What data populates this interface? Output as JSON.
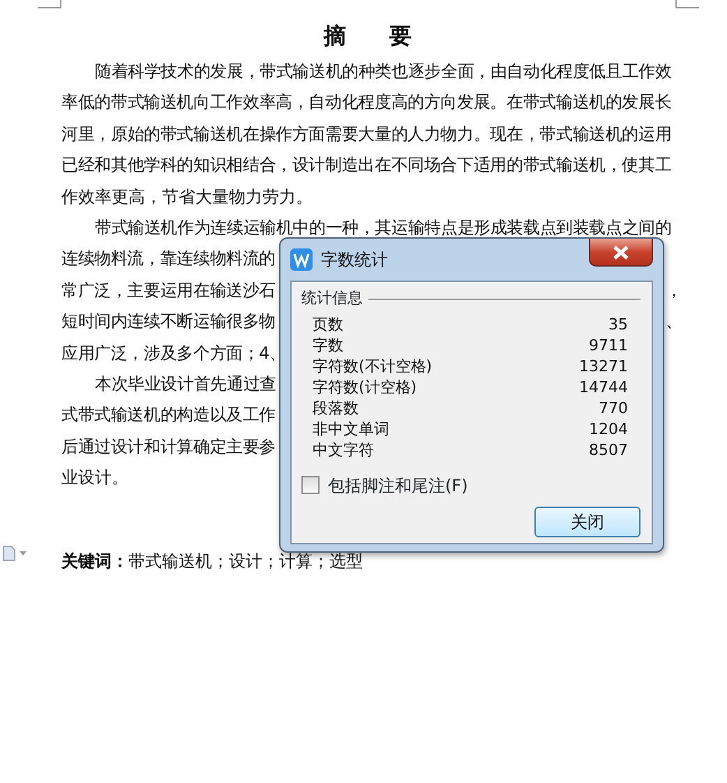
{
  "document": {
    "title": "摘 要",
    "lines": [
      {
        "text": "随着科学技术的发展，带式输送机的种类也逐步全面，由自动化程度低且工作效",
        "indent": true
      },
      {
        "text": "率低的带式输送机向工作效率高，自动化程度高的方向发展。在带式输送机的发展长",
        "indent": false
      },
      {
        "text": "河里，原始的带式输送机在操作方面需要大量的人力物力。现在，带式输送机的运用",
        "indent": false
      },
      {
        "text": "已经和其他学科的知识相结合，设计制造出在不同场合下适用的带式输送机，使其工",
        "indent": false
      },
      {
        "text": "作效率更高，节省大量物力劳力。",
        "indent": false,
        "last": true
      },
      {
        "text": "带式输送机作为连续运输机中的一种，其运输特点是形成装载点到装载点之间的",
        "indent": true
      },
      {
        "left": "连续物料流，靠连续物料流的",
        "indent": false
      },
      {
        "left": "常广泛，主要运用在输送沙石",
        "right": "，",
        "indent": false
      },
      {
        "left": "短时间内连续不断运输很多物",
        "right": "、",
        "indent": false
      },
      {
        "left": "应用广泛，涉及多个方面；4、",
        "indent": false
      },
      {
        "left": "本次毕业设计首先通过查",
        "indent": true
      },
      {
        "left": "式带式输送机的构造以及工作",
        "indent": false
      },
      {
        "left": "后通过设计和计算确定主要参",
        "indent": false
      },
      {
        "text": "业设计。",
        "indent": false,
        "last": true
      }
    ],
    "keywords": {
      "label": "关键词：",
      "text": "带式输送机；设计；计算；选型"
    }
  },
  "dialog": {
    "title": "字数统计",
    "group": "统计信息",
    "rows": [
      {
        "label": "页数",
        "value": "35"
      },
      {
        "label": "字数",
        "value": "9711"
      },
      {
        "label": "字符数(不计空格)",
        "value": "13271"
      },
      {
        "label": "字符数(计空格)",
        "value": "14744"
      },
      {
        "label": "段落数",
        "value": "770"
      },
      {
        "label": "非中文单词",
        "value": "1204"
      },
      {
        "label": "中文字符",
        "value": "8507"
      }
    ],
    "checkbox": {
      "label": "包括脚注和尾注(F)",
      "checked": false
    },
    "button": "关闭"
  }
}
